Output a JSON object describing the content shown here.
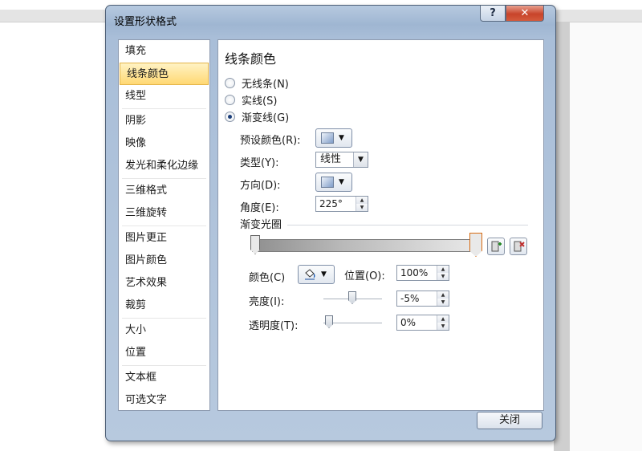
{
  "window": {
    "title": "设置形状格式",
    "help_label": "?",
    "close_label": "✕"
  },
  "nav": {
    "items": [
      {
        "label": "填充",
        "selected": false
      },
      {
        "label": "线条颜色",
        "selected": true
      },
      {
        "label": "线型",
        "selected": false
      },
      {
        "label": "阴影",
        "selected": false
      },
      {
        "label": "映像",
        "selected": false
      },
      {
        "label": "发光和柔化边缘",
        "selected": false
      },
      {
        "label": "三维格式",
        "selected": false
      },
      {
        "label": "三维旋转",
        "selected": false
      },
      {
        "label": "图片更正",
        "selected": false
      },
      {
        "label": "图片颜色",
        "selected": false
      },
      {
        "label": "艺术效果",
        "selected": false
      },
      {
        "label": "裁剪",
        "selected": false
      },
      {
        "label": "大小",
        "selected": false
      },
      {
        "label": "位置",
        "selected": false
      },
      {
        "label": "文本框",
        "selected": false
      },
      {
        "label": "可选文字",
        "selected": false
      }
    ]
  },
  "panel": {
    "title": "线条颜色",
    "radio": {
      "none": "无线条(N)",
      "solid": "实线(S)",
      "gradient": "渐变线(G)",
      "checked": "gradient"
    },
    "preset_label": "预设颜色(R):",
    "type_label": "类型(Y):",
    "type_value": "线性",
    "direction_label": "方向(D):",
    "angle_label": "角度(E):",
    "angle_value": "225°",
    "stops_label": "渐变光圈",
    "color_label": "颜色(C)",
    "position_label": "位置(O):",
    "position_value": "100%",
    "brightness_label": "亮度(I):",
    "brightness_value": "-5%",
    "transparency_label": "透明度(T):",
    "transparency_value": "0%"
  },
  "footer": {
    "close_label": "关闭"
  },
  "icons": {
    "dropdown": "▼",
    "spin_up": "▲",
    "spin_down": "▼",
    "add_stop": "add-stop-icon",
    "remove_stop": "remove-stop-icon",
    "paint_bucket": "paint-bucket-icon"
  },
  "colors": {
    "accent_stop": "#d76a12",
    "selected_nav": "#ffd873"
  }
}
